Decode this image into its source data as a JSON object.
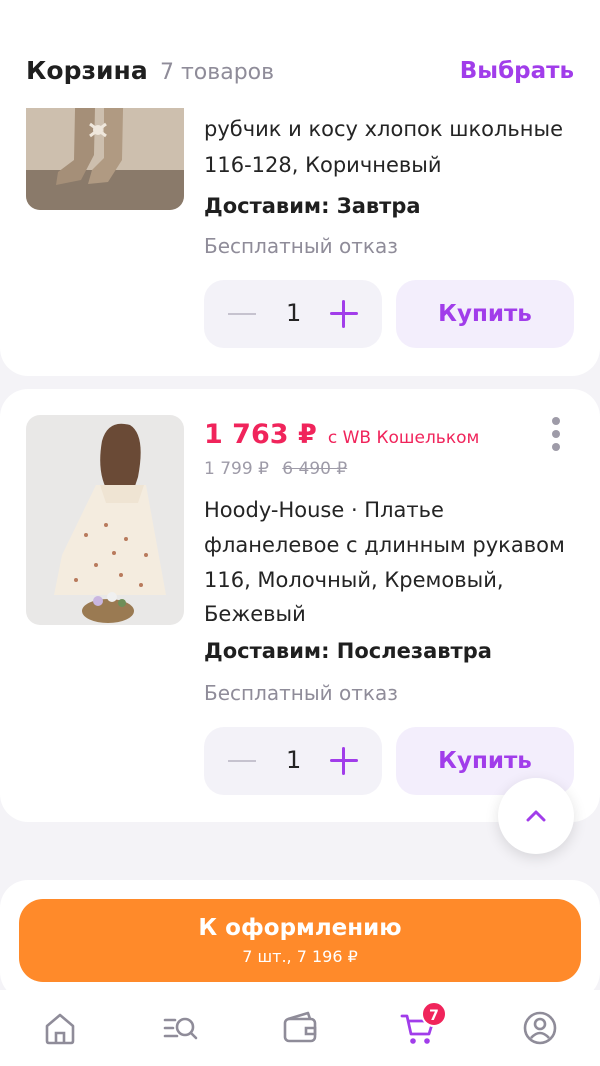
{
  "header": {
    "title": "Корзина",
    "count": "7 товаров",
    "select_label": "Выбрать"
  },
  "item1": {
    "description_line1": "рубчик и косу хлопок школьные",
    "description_line2": "116-128, Коричневый",
    "delivery": "Доставим: Завтра",
    "refund": "Бесплатный отказ",
    "quantity": "1",
    "buy_label": "Купить"
  },
  "item2": {
    "price": "1 763 ₽",
    "wallet_note": "с WB Кошельком",
    "price_regular": "1 799 ₽",
    "price_old": "6 490 ₽",
    "description_line1": "Hoody-House · Платье",
    "description_line2": "фланелевое с длинным рукавом",
    "description_line3": "116, Молочный, Кремовый,",
    "description_line4": "Бежевый",
    "delivery": "Доставим: Послезавтра",
    "refund": "Бесплатный отказ",
    "quantity": "1",
    "buy_label": "Купить"
  },
  "checkout": {
    "label": "К оформлению",
    "summary": "7 шт., 7 196 ₽"
  },
  "tabbar": {
    "items": [
      "home-icon",
      "catalog-search-icon",
      "wallet-icon",
      "cart-icon",
      "profile-icon"
    ],
    "cart_badge": "7",
    "active_color": "#a13dea"
  },
  "colors": {
    "accent": "#a13dea",
    "price": "#f0245b",
    "checkout": "#ff8a2a"
  }
}
